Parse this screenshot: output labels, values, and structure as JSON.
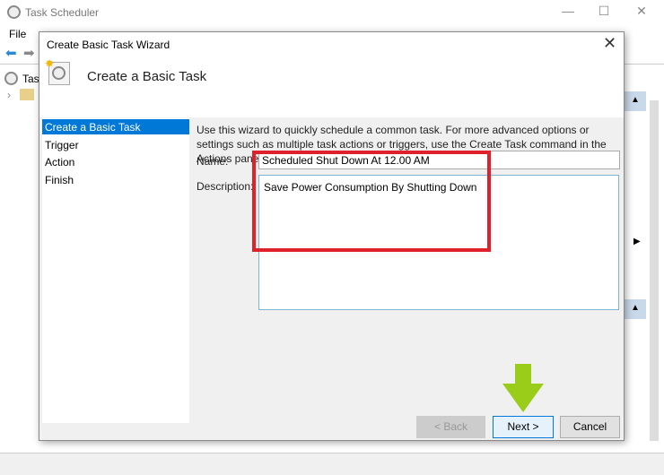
{
  "app": {
    "title": "Task Scheduler",
    "menu_file": "File",
    "tree_item": "Task"
  },
  "dialog": {
    "title": "Create Basic Task Wizard",
    "heading": "Create a Basic Task",
    "nav": [
      {
        "label": "Create a Basic Task",
        "selected": true
      },
      {
        "label": "Trigger"
      },
      {
        "label": "Action"
      },
      {
        "label": "Finish"
      }
    ],
    "intro": "Use this wizard to quickly schedule a common task.  For more advanced options or settings such as multiple task actions or triggers, use the Create Task command in the Actions pane.",
    "name_label": "Name:",
    "name_value": "Scheduled Shut Down At 12.00 AM",
    "description_label": "Description:",
    "description_value": "Save Power Consumption By Shutting Down",
    "buttons": {
      "back": "< Back",
      "next": "Next >",
      "cancel": "Cancel"
    }
  },
  "annotations": {
    "highlight_color": "#e0202a",
    "arrow_color": "#9acd1a"
  },
  "colors": {
    "accent": "#0078d7"
  }
}
